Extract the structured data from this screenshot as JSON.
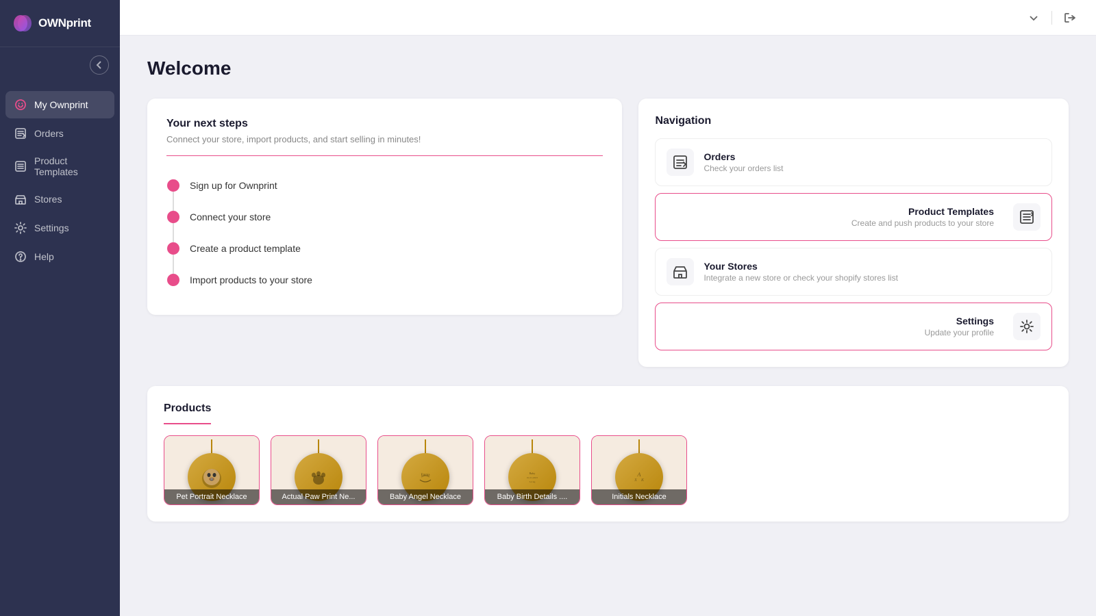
{
  "app": {
    "name": "OWNprint",
    "logo_text_own": "OWN",
    "logo_text_print": "print"
  },
  "sidebar": {
    "items": [
      {
        "id": "my-ownprint",
        "label": "My Ownprint",
        "active": true
      },
      {
        "id": "orders",
        "label": "Orders",
        "active": false
      },
      {
        "id": "product-templates",
        "label": "Product Templates",
        "active": false
      },
      {
        "id": "stores",
        "label": "Stores",
        "active": false
      },
      {
        "id": "settings",
        "label": "Settings",
        "active": false
      },
      {
        "id": "help",
        "label": "Help",
        "active": false
      }
    ]
  },
  "page": {
    "title": "Welcome"
  },
  "next_steps": {
    "title": "Your next steps",
    "subtitle": "Connect your store, import products, and start selling in minutes!",
    "steps": [
      {
        "label": "Sign up for Ownprint",
        "done": true
      },
      {
        "label": "Connect your store",
        "done": true
      },
      {
        "label": "Create a product template",
        "done": true
      },
      {
        "label": "Import products to your store",
        "done": true
      }
    ]
  },
  "navigation_card": {
    "title": "Navigation",
    "items": [
      {
        "id": "orders",
        "title": "Orders",
        "subtitle": "Check your orders list",
        "featured": false
      },
      {
        "id": "product-templates",
        "title": "Product Templates",
        "subtitle": "Create and push products to your store",
        "featured": true
      },
      {
        "id": "your-stores",
        "title": "Your Stores",
        "subtitle": "Integrate a new store or check your shopify stores list",
        "featured": false
      },
      {
        "id": "settings",
        "title": "Settings",
        "subtitle": "Update your profile",
        "featured": true
      }
    ]
  },
  "products": {
    "title": "Products",
    "items": [
      {
        "id": 1,
        "label": "Pet Portrait Necklace"
      },
      {
        "id": 2,
        "label": "Actual Paw Print Ne..."
      },
      {
        "id": 3,
        "label": "Baby Angel Necklace"
      },
      {
        "id": 4,
        "label": "Baby Birth Details ...."
      },
      {
        "id": 5,
        "label": "Initials Necklace"
      }
    ]
  },
  "topbar": {
    "chevron_tooltip": "collapse",
    "logout_tooltip": "logout"
  }
}
